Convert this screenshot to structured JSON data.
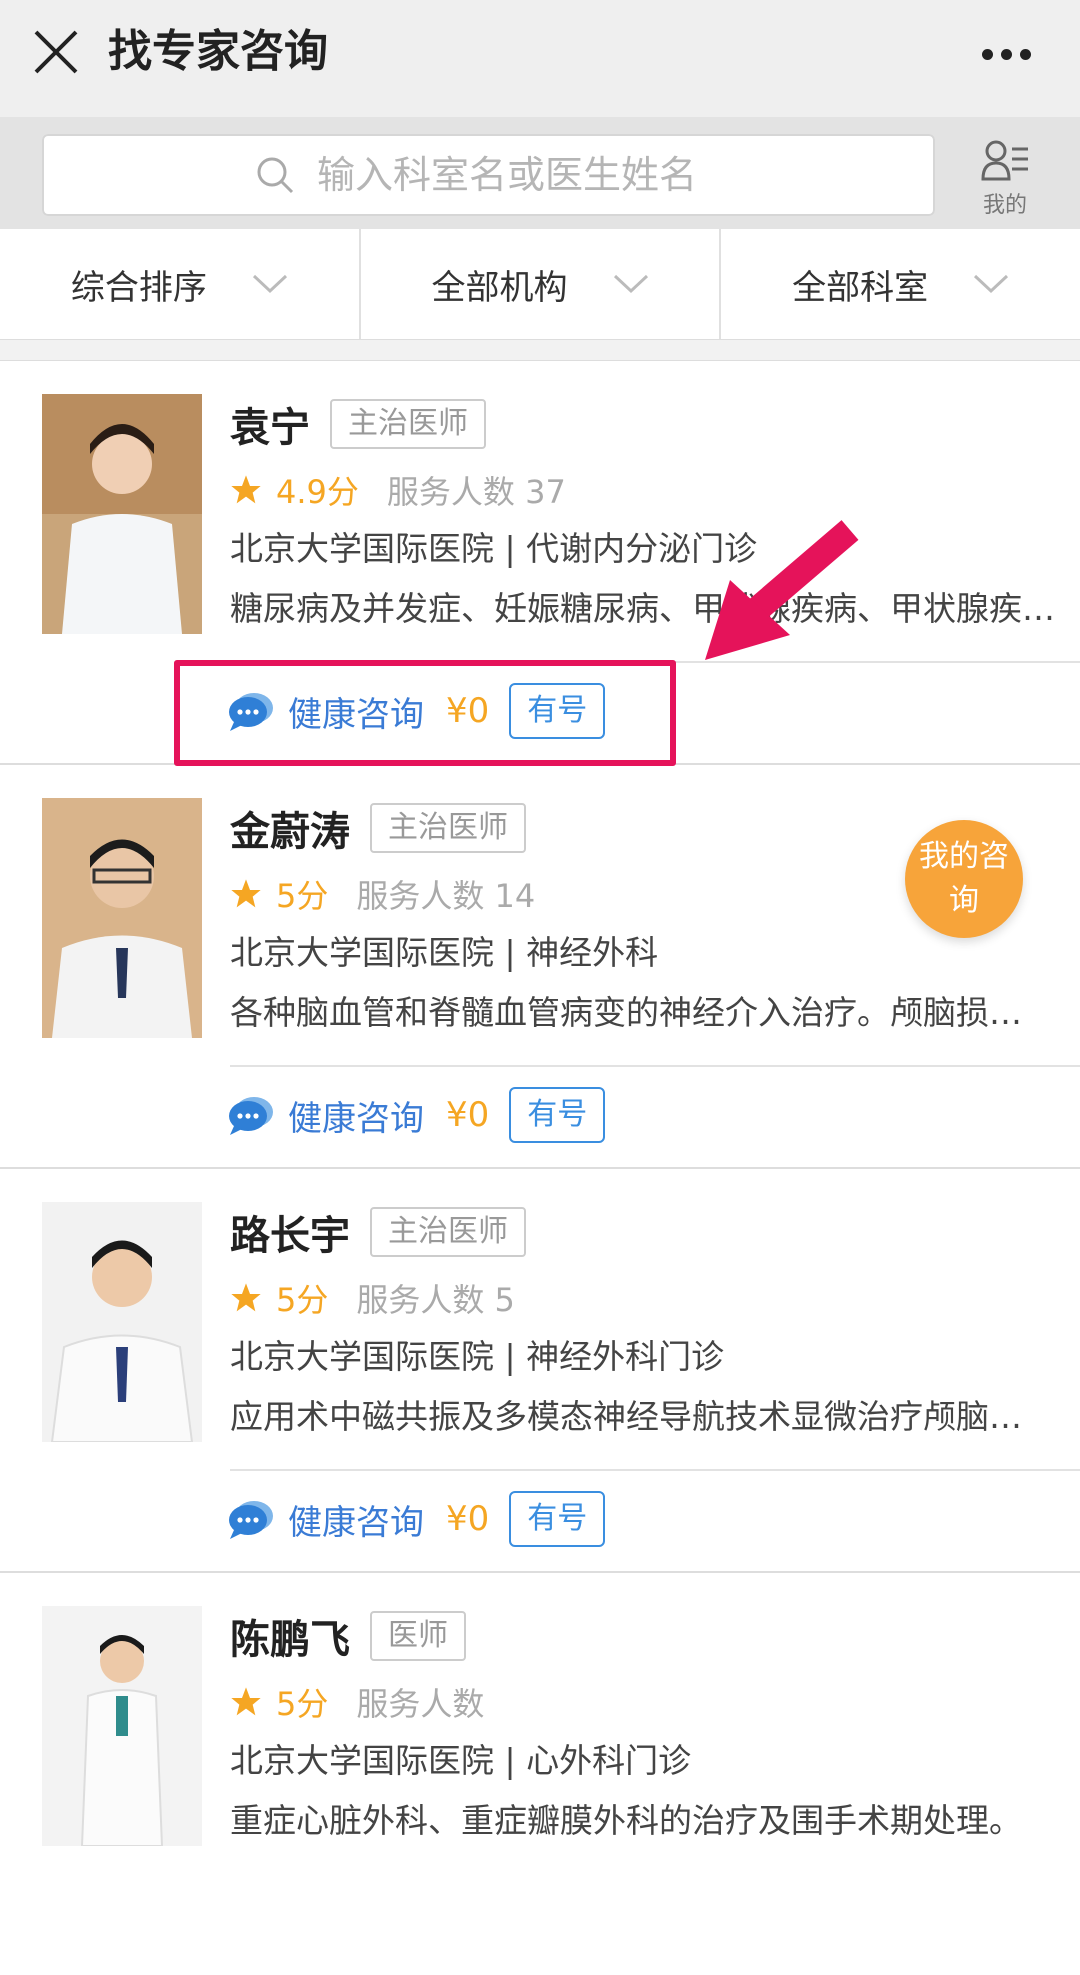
{
  "header": {
    "title": "找专家咨询"
  },
  "search": {
    "placeholder": "输入科室名或医生姓名",
    "mine_label": "我的"
  },
  "filters": [
    {
      "label": "综合排序"
    },
    {
      "label": "全部机构"
    },
    {
      "label": "全部科室"
    }
  ],
  "consult_label": "健康咨询",
  "doctors": [
    {
      "name": "袁宁",
      "title": "主治医师",
      "score": "4.9分",
      "served": "服务人数 37",
      "hospital": "北京大学国际医院 | 代谢内分泌门诊",
      "specialty": "糖尿病及并发症、妊娠糖尿病、甲状腺疾病、甲状腺疾病、甲…",
      "price": "¥0",
      "availability": "有号"
    },
    {
      "name": "金蔚涛",
      "title": "主治医师",
      "score": "5分",
      "served": "服务人数 14",
      "hospital": "北京大学国际医院 | 神经外科",
      "specialty": "各种脑血管和脊髓血管病变的神经介入治疗。颅脑损…",
      "price": "¥0",
      "availability": "有号"
    },
    {
      "name": "路长宇",
      "title": "主治医师",
      "score": "5分",
      "served": "服务人数 5",
      "hospital": "北京大学国际医院 | 神经外科门诊",
      "specialty": "应用术中磁共振及多模态神经导航技术显微治疗颅脑…",
      "price": "¥0",
      "availability": "有号"
    },
    {
      "name": "陈鹏飞",
      "title": "医师",
      "score": "5分",
      "served": "服务人数",
      "hospital": "北京大学国际医院 | 心外科门诊",
      "specialty": "重症心脏外科、重症瓣膜外科的治疗及围手术期处理。",
      "price": "",
      "availability": ""
    }
  ],
  "my_consult": "我的咨询",
  "colors": {
    "accent_blue": "#3a7bd5",
    "accent_orange": "#f5a623",
    "highlight_red": "#e5135a"
  }
}
